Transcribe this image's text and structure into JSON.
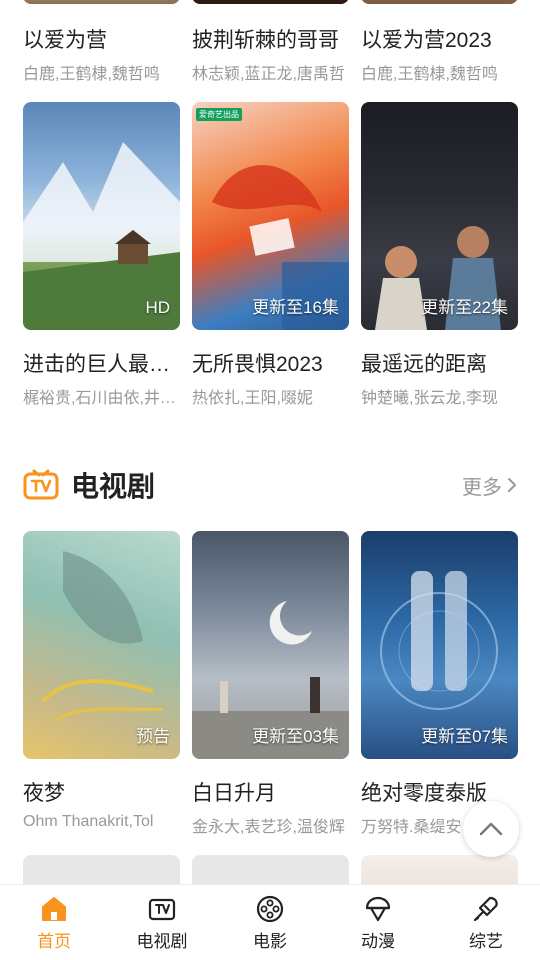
{
  "top_row": [
    {
      "title": "以爱为营",
      "cast": "白鹿,王鹤棣,魏哲鸣"
    },
    {
      "title": "披荆斩棘的哥哥",
      "cast": "林志颖,蓝正龙,唐禹哲"
    },
    {
      "title": "以爱为营2023",
      "cast": "白鹿,王鹤棣,魏哲鸣"
    }
  ],
  "movies": [
    {
      "title": "进击的巨人最终季",
      "cast": "梶裕贵,石川由依,井上麻里奈",
      "badge": "HD",
      "tag": ""
    },
    {
      "title": "无所畏惧2023",
      "cast": "热依扎,王阳,啜妮",
      "badge": "更新至16集",
      "tag": "爱奇艺出品"
    },
    {
      "title": "最遥远的距离",
      "cast": "钟楚曦,张云龙,李现",
      "badge": "更新至22集",
      "tag": ""
    }
  ],
  "tv_section": {
    "title": "电视剧",
    "more": "更多"
  },
  "tv": [
    {
      "title": "夜梦",
      "cast": "Ohm Thanakrit,Tol",
      "badge": "预告"
    },
    {
      "title": "白日升月",
      "cast": "金永大,表艺珍,温俊辉",
      "badge": "更新至03集"
    },
    {
      "title": "绝对零度泰版",
      "cast": "万努特.桑缇安",
      "badge": "更新至07集"
    }
  ],
  "tabs": [
    {
      "label": "首页",
      "icon": "home-icon",
      "active": true
    },
    {
      "label": "电视剧",
      "icon": "tv-icon",
      "active": false
    },
    {
      "label": "电影",
      "icon": "film-reel-icon",
      "active": false
    },
    {
      "label": "动漫",
      "icon": "anime-icon",
      "active": false
    },
    {
      "label": "综艺",
      "icon": "variety-icon",
      "active": false
    }
  ],
  "colors": {
    "accent": "#f7931e",
    "muted": "#999999"
  }
}
